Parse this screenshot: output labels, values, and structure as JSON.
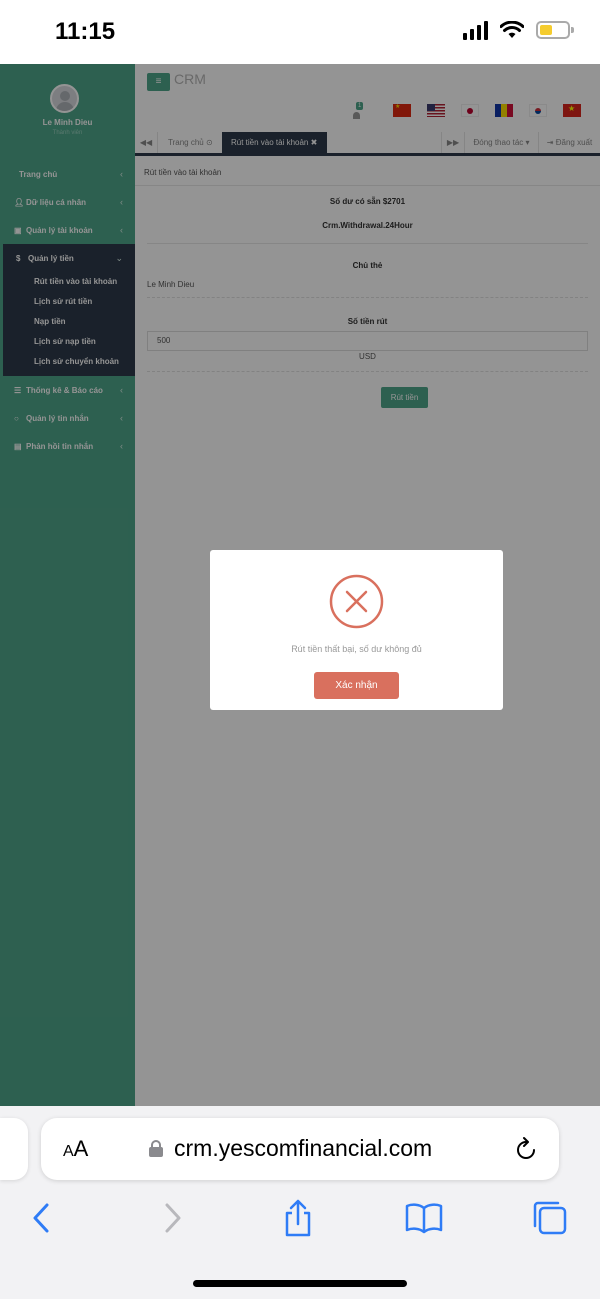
{
  "status_bar": {
    "time": "11:15"
  },
  "sidebar": {
    "user_name": "Le Minh Dieu",
    "user_role": "Thành viên",
    "items": [
      {
        "label": "Trang chủ"
      },
      {
        "label": "Dữ liệu cá nhân"
      },
      {
        "label": "Quản lý tài khoản"
      },
      {
        "label": "Quản lý tiền"
      },
      {
        "label": "Thống kê & Báo cáo"
      },
      {
        "label": "Quản lý tin nhắn"
      },
      {
        "label": "Phản hồi tin nhắn"
      }
    ],
    "submenu": [
      {
        "label": "Rút tiền vào tài khoản"
      },
      {
        "label": "Lịch sử rút tiền"
      },
      {
        "label": "Nạp tiền"
      },
      {
        "label": "Lịch sử nạp tiền"
      },
      {
        "label": "Lịch sử chuyển khoản"
      }
    ]
  },
  "header": {
    "brand": "CRM",
    "notification_count": "1",
    "menu_icon": "hamburger-icon"
  },
  "tabs": {
    "home": "Trang chủ",
    "active": "Rút tiền vào tài khoản",
    "operations": "Đóng thao tác",
    "logout": "Đăng xuất"
  },
  "panel": {
    "title": "Rút tiền vào tài khoản",
    "balance": "Số dư có sẵn $2701",
    "hours": "Crm.Withdrawal.24Hour",
    "owner_label": "Chủ thẻ",
    "owner_value": "Le Minh Dieu",
    "amount_label": "Số tiền rút",
    "amount_value": "500",
    "currency": "USD",
    "withdraw_button": "Rút tiền"
  },
  "modal": {
    "message": "Rút tiền thất bại, số dư không đủ",
    "confirm_button": "Xác nhận",
    "color": "#d9705e"
  },
  "browser": {
    "url": "crm.yescomfinancial.com",
    "aa_big": "A",
    "aa_small": "A"
  },
  "colors": {
    "sidebar": "#4fa58a",
    "dark": "#2e3a4a",
    "error": "#d9705e"
  }
}
